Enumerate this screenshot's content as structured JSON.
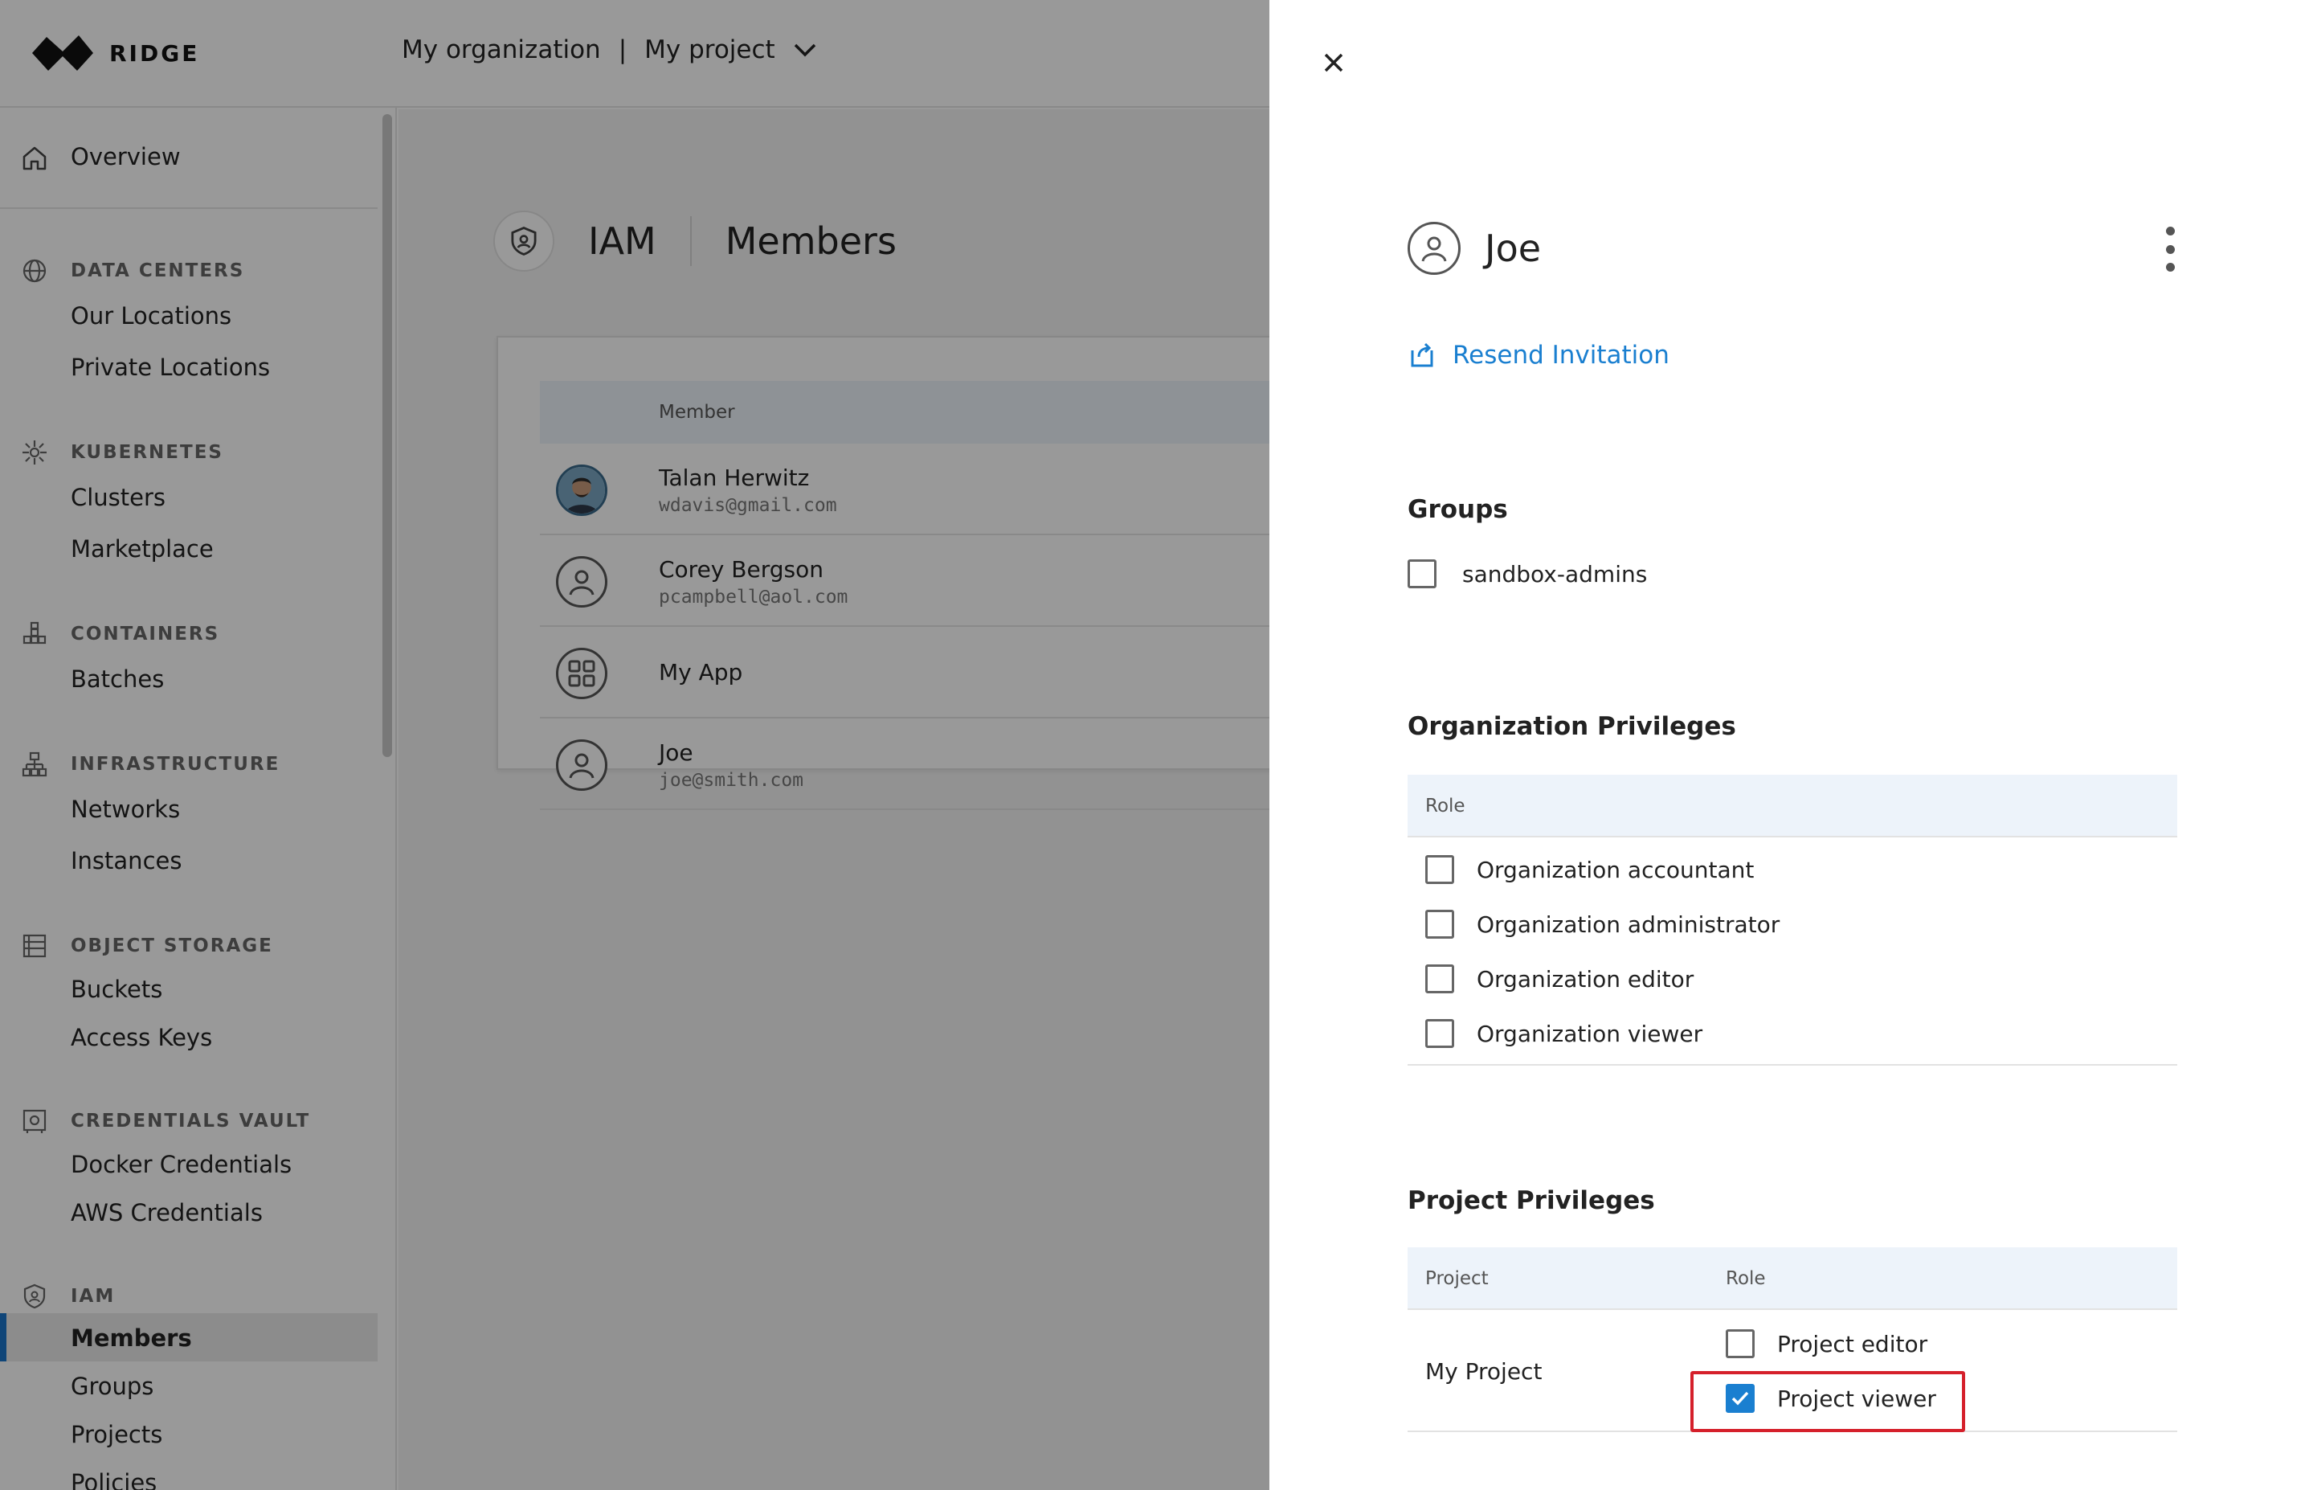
{
  "brand": {
    "name": "RIDGE"
  },
  "breadcrumb": {
    "organization": "My organization",
    "separator": "|",
    "project": "My project"
  },
  "sidebar": {
    "overview": "Overview",
    "sections": [
      {
        "title": "DATA CENTERS",
        "icon": "globe-icon",
        "items": [
          "Our Locations",
          "Private Locations"
        ]
      },
      {
        "title": "KUBERNETES",
        "icon": "kubernetes-icon",
        "items": [
          "Clusters",
          "Marketplace"
        ]
      },
      {
        "title": "CONTAINERS",
        "icon": "containers-icon",
        "items": [
          "Batches"
        ]
      },
      {
        "title": "INFRASTRUCTURE",
        "icon": "network-icon",
        "items": [
          "Networks",
          "Instances"
        ]
      },
      {
        "title": "OBJECT STORAGE",
        "icon": "storage-icon",
        "items": [
          "Buckets",
          "Access Keys"
        ]
      },
      {
        "title": "CREDENTIALS VAULT",
        "icon": "vault-icon",
        "items": [
          "Docker Credentials",
          "AWS Credentials"
        ]
      },
      {
        "title": "IAM",
        "icon": "shield-icon",
        "items": [
          "Members",
          "Groups",
          "Projects",
          "Policies"
        ],
        "active": "Members"
      }
    ]
  },
  "page": {
    "section": "IAM",
    "title": "Members"
  },
  "members_table": {
    "column": "Member",
    "rows": [
      {
        "name": "Talan Herwitz",
        "email": "wdavis@gmail.com",
        "avatar": "photo-avatar"
      },
      {
        "name": "Corey Bergson",
        "email": "pcampbell@aol.com",
        "avatar": "user-icon"
      },
      {
        "name": "My App",
        "email": "",
        "avatar": "app-icon"
      },
      {
        "name": "Joe",
        "email": "joe@smith.com",
        "avatar": "user-icon"
      }
    ]
  },
  "drawer": {
    "user_name": "Joe",
    "resend_label": "Resend Invitation",
    "groups": {
      "title": "Groups",
      "options": [
        {
          "label": "sandbox-admins",
          "checked": false
        }
      ]
    },
    "org_privileges": {
      "title": "Organization Privileges",
      "column": "Role",
      "roles": [
        {
          "label": "Organization accountant",
          "checked": false
        },
        {
          "label": "Organization administrator",
          "checked": false
        },
        {
          "label": "Organization editor",
          "checked": false
        },
        {
          "label": "Organization viewer",
          "checked": false
        }
      ]
    },
    "project_privileges": {
      "title": "Project Privileges",
      "col_project": "Project",
      "col_role": "Role",
      "project": "My Project",
      "roles": [
        {
          "label": "Project editor",
          "checked": false
        },
        {
          "label": "Project viewer",
          "checked": true
        }
      ]
    }
  },
  "colors": {
    "accent": "#1a7fd0",
    "highlight": "#d5202b",
    "overlay": "rgba(0,0,0,0.40)"
  }
}
